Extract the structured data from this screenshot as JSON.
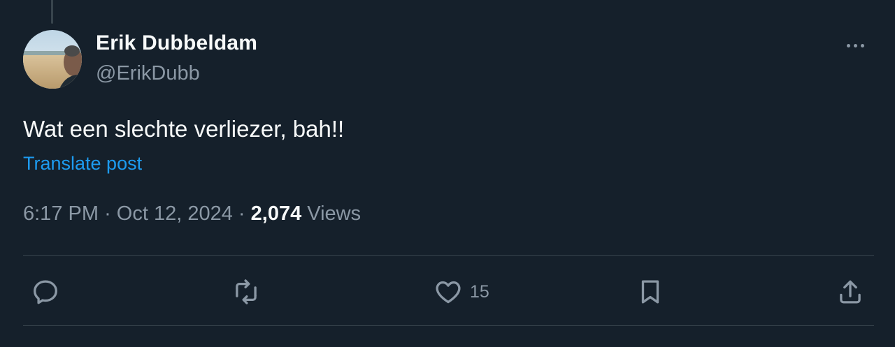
{
  "tweet": {
    "author_name": "Erik Dubbeldam",
    "handle": "@ErikDubb",
    "text": "Wat een slechte verliezer, bah!!",
    "translate_label": "Translate post",
    "time": "6:17 PM",
    "date": "Oct 12, 2024",
    "views_count": "2,074",
    "views_label": "Views",
    "separator": "·"
  },
  "actions": {
    "reply_icon": "reply-icon",
    "retweet_icon": "retweet-icon",
    "like_icon": "heart-icon",
    "like_count": "15",
    "bookmark_icon": "bookmark-icon",
    "share_icon": "share-icon"
  },
  "colors": {
    "background": "#15202b",
    "text_primary": "#f7f9f9",
    "text_secondary": "#8b98a5",
    "accent": "#1d9bf0",
    "divider": "#38444d"
  }
}
